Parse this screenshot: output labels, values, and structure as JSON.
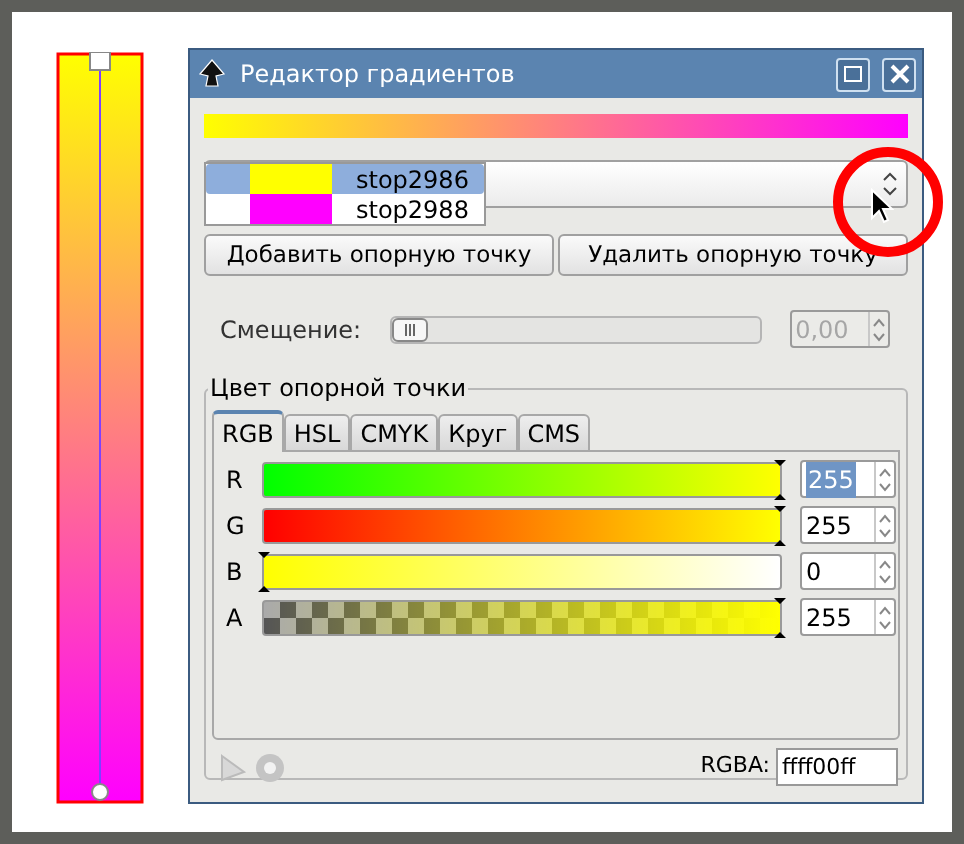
{
  "window": {
    "title": "Редактор градиентов"
  },
  "stops": [
    {
      "name": "stop2986",
      "color": "#ffff00",
      "selected": true
    },
    {
      "name": "stop2988",
      "color": "#ff00ff",
      "selected": false
    }
  ],
  "buttons": [
    "Добавить опорную точку",
    "Удалить опорную точку"
  ],
  "offset": {
    "label": "Смещение:",
    "level": 0,
    "value": "0,00",
    "disabled": true
  },
  "color_frame": {
    "title": "Цвет опорной точки",
    "tabs": [
      {
        "label": "RGB",
        "selected": true
      },
      {
        "label": "HSL",
        "selected": false
      },
      {
        "label": "CMYK",
        "selected": false
      },
      {
        "label": "Круг",
        "selected": false
      },
      {
        "label": "CMS",
        "selected": false
      }
    ],
    "channels": [
      {
        "name": "R",
        "level": 1,
        "value": "255",
        "selected": true
      },
      {
        "name": "G",
        "level": 1,
        "value": "255",
        "selected": false
      },
      {
        "name": "B",
        "level": 0,
        "value": "0",
        "selected": false
      },
      {
        "name": "A",
        "level": 1,
        "value": "255",
        "selected": false
      }
    ]
  },
  "rgba": {
    "label": "RGBA:",
    "value": "ffff00ff"
  }
}
